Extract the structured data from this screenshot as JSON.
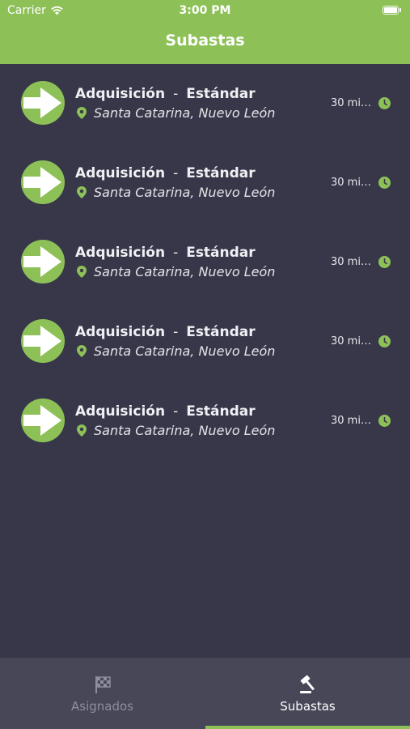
{
  "status_bar": {
    "carrier": "Carrier",
    "time": "3:00 PM"
  },
  "nav": {
    "title": "Subastas"
  },
  "colors": {
    "accent": "#8dc157",
    "background": "#373749",
    "tabbar": "#474758"
  },
  "items": [
    {
      "type": "Adquisición",
      "separator": "-",
      "level": "Estándar",
      "location": "Santa Catarina, Nuevo León",
      "time": "30 mi…",
      "avatar_icon": "arrow-right-icon",
      "location_icon": "map-pin-icon",
      "time_icon": "clock-icon"
    },
    {
      "type": "Adquisición",
      "separator": "-",
      "level": "Estándar",
      "location": "Santa Catarina, Nuevo León",
      "time": "30 mi…",
      "avatar_icon": "arrow-right-icon",
      "location_icon": "map-pin-icon",
      "time_icon": "clock-icon"
    },
    {
      "type": "Adquisición",
      "separator": "-",
      "level": "Estándar",
      "location": "Santa Catarina, Nuevo León",
      "time": "30 mi…",
      "avatar_icon": "arrow-right-icon",
      "location_icon": "map-pin-icon",
      "time_icon": "clock-icon"
    },
    {
      "type": "Adquisición",
      "separator": "-",
      "level": "Estándar",
      "location": "Santa Catarina, Nuevo León",
      "time": "30 mi…",
      "avatar_icon": "arrow-right-icon",
      "location_icon": "map-pin-icon",
      "time_icon": "clock-icon"
    },
    {
      "type": "Adquisición",
      "separator": "-",
      "level": "Estándar",
      "location": "Santa Catarina, Nuevo León",
      "time": "30 mi…",
      "avatar_icon": "arrow-right-icon",
      "location_icon": "map-pin-icon",
      "time_icon": "clock-icon"
    }
  ],
  "tabs": [
    {
      "label": "Asignados",
      "icon": "checkered-flag-icon",
      "selected": false
    },
    {
      "label": "Subastas",
      "icon": "gavel-icon",
      "selected": true
    }
  ]
}
